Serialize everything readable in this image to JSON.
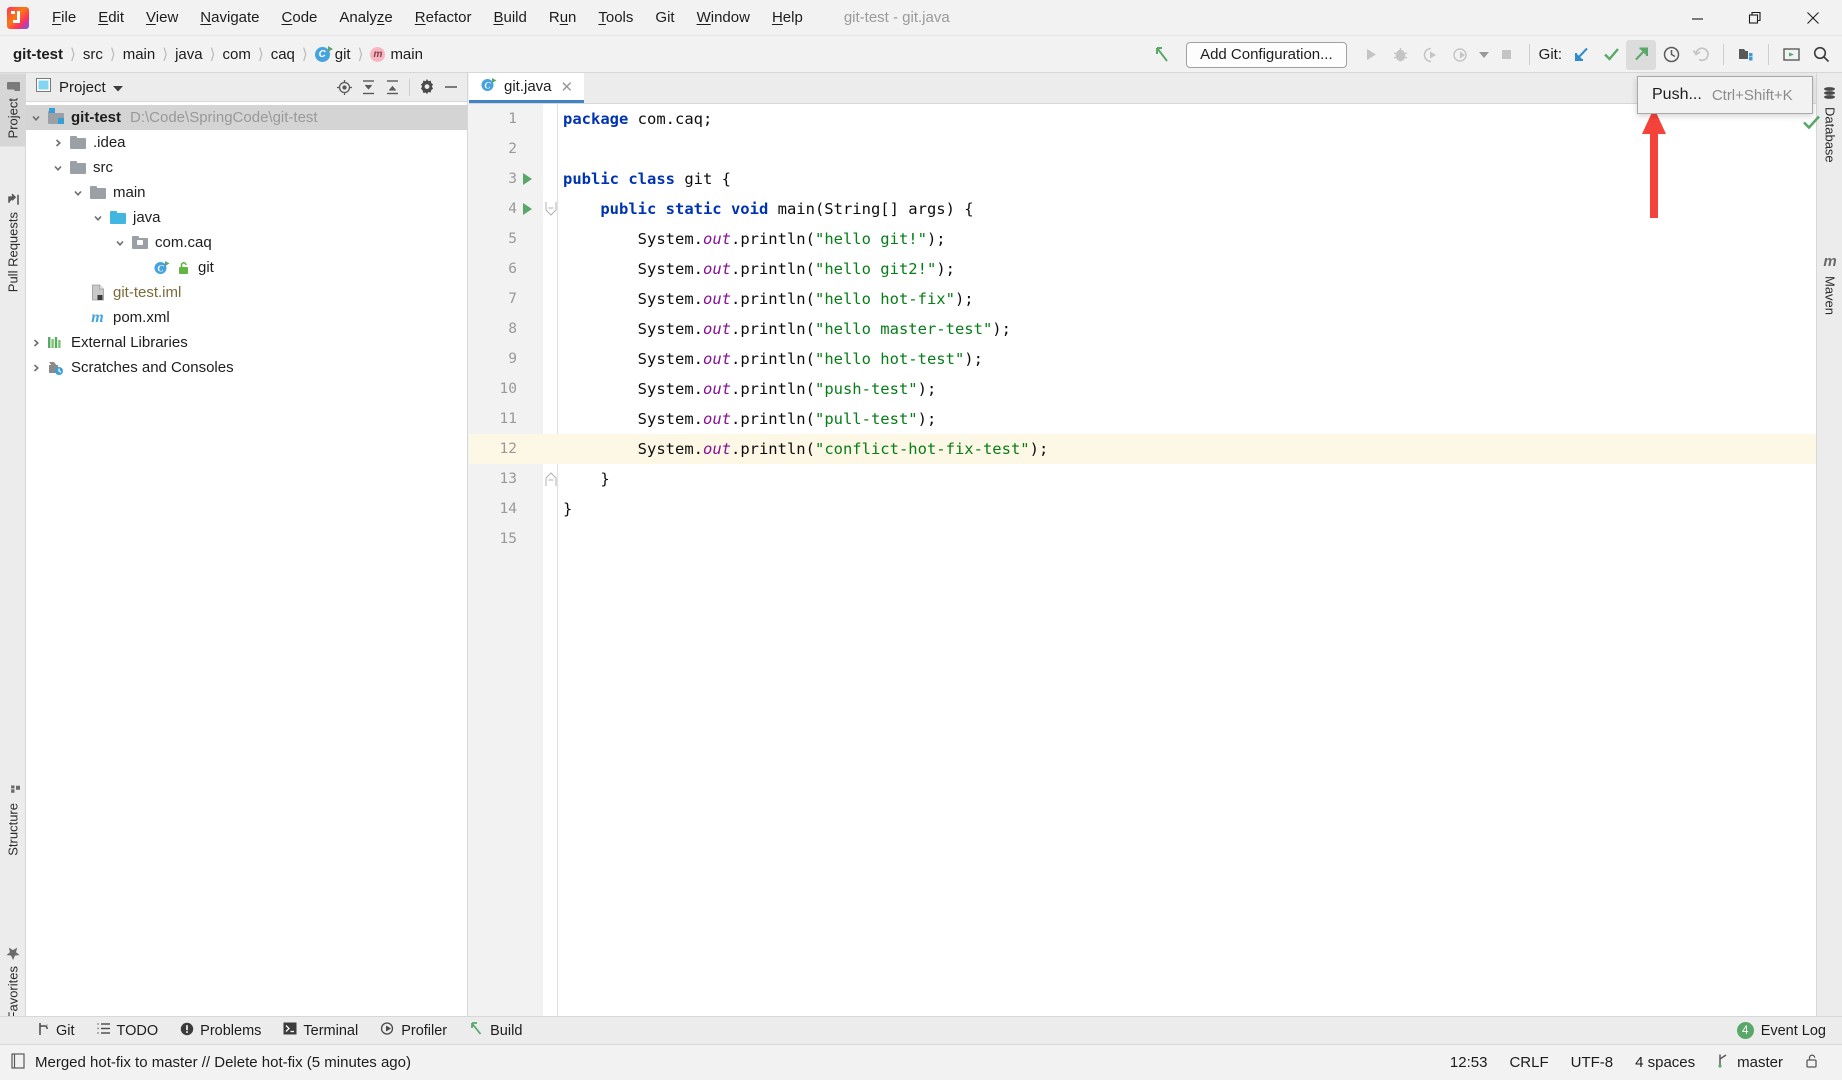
{
  "window": {
    "title": "git-test - git.java",
    "logo_icon": "intellij-idea-logo",
    "minimize_icon": "minimize-icon",
    "restore_icon": "restore-icon",
    "close_icon": "close-icon"
  },
  "menu": [
    {
      "label": "File",
      "mnemonic": "F"
    },
    {
      "label": "Edit",
      "mnemonic": "E"
    },
    {
      "label": "View",
      "mnemonic": "V"
    },
    {
      "label": "Navigate",
      "mnemonic": "N"
    },
    {
      "label": "Code",
      "mnemonic": "C"
    },
    {
      "label": "Analyze",
      "mnemonic": "z"
    },
    {
      "label": "Refactor",
      "mnemonic": "R"
    },
    {
      "label": "Build",
      "mnemonic": "B"
    },
    {
      "label": "Run",
      "mnemonic": "u"
    },
    {
      "label": "Tools",
      "mnemonic": "T"
    },
    {
      "label": "Git",
      "mnemonic": ""
    },
    {
      "label": "Window",
      "mnemonic": "W"
    },
    {
      "label": "Help",
      "mnemonic": "H"
    }
  ],
  "breadcrumbs": [
    {
      "label": "git-test",
      "bold": true,
      "icon": ""
    },
    {
      "label": "src",
      "bold": false,
      "icon": ""
    },
    {
      "label": "main",
      "bold": false,
      "icon": ""
    },
    {
      "label": "java",
      "bold": false,
      "icon": ""
    },
    {
      "label": "com",
      "bold": false,
      "icon": ""
    },
    {
      "label": "caq",
      "bold": false,
      "icon": ""
    },
    {
      "label": "git",
      "bold": false,
      "icon": "class-icon"
    },
    {
      "label": "main",
      "bold": false,
      "icon": "method-icon"
    }
  ],
  "toolbar": {
    "back_icon": "back-arrow-icon",
    "add_configuration_label": "Add Configuration...",
    "run_icon": "run-icon",
    "debug_icon": "debug-icon",
    "run_coverage_icon": "run-with-coverage-icon",
    "profile_icon": "profile-icon",
    "dropdown_icon": "chevron-down-icon",
    "stop_icon": "stop-icon",
    "git_label": "Git:",
    "git_update_icon": "git-update-project-icon",
    "git_commit_icon": "git-commit-icon",
    "git_push_icon": "git-push-icon",
    "git_history_icon": "git-history-icon",
    "git_rollback_icon": "git-rollback-icon",
    "project_structure_icon": "project-structure-icon",
    "select_in_icon": "select-in-icon",
    "search_icon": "search-everywhere-icon"
  },
  "tooltip": {
    "label": "Push...",
    "shortcut": "Ctrl+Shift+K",
    "annotation_color": "#f4433a"
  },
  "left_strip": {
    "tabs": [
      {
        "label": "Project",
        "icon": "project-icon",
        "selected": true
      },
      {
        "label": "Pull Requests",
        "icon": "pull-requests-icon",
        "selected": false
      }
    ],
    "bottom_tabs": [
      {
        "label": "Structure",
        "icon": "structure-icon"
      },
      {
        "label": "Favorites",
        "icon": "favorites-star-icon"
      }
    ]
  },
  "right_strip": {
    "tabs": [
      {
        "label": "Database",
        "icon": "database-icon"
      },
      {
        "label": "Maven",
        "icon": "maven-icon"
      }
    ]
  },
  "project_panel": {
    "title": "Project",
    "dropdown_icon": "chevron-down-icon",
    "panel_icon": "project-view-icon",
    "actions": [
      {
        "name": "locate-icon"
      },
      {
        "name": "expand-all-icon"
      },
      {
        "name": "collapse-all-icon"
      },
      {
        "name": "settings-gear-icon"
      },
      {
        "name": "hide-icon"
      }
    ],
    "tree": [
      {
        "label": "git-test",
        "secondary": "D:\\Code\\SpringCode\\git-test",
        "indent": 0,
        "chevron": "down",
        "icon": "module-folder-icon",
        "bold": true,
        "selected": true
      },
      {
        "label": ".idea",
        "secondary": "",
        "indent": 1,
        "chevron": "right",
        "icon": "folder-icon",
        "bold": false,
        "selected": false
      },
      {
        "label": "src",
        "secondary": "",
        "indent": 1,
        "chevron": "down",
        "icon": "folder-icon",
        "bold": false,
        "selected": false
      },
      {
        "label": "main",
        "secondary": "",
        "indent": 2,
        "chevron": "down",
        "icon": "folder-icon",
        "bold": false,
        "selected": false
      },
      {
        "label": "java",
        "secondary": "",
        "indent": 3,
        "chevron": "down",
        "icon": "source-folder-icon",
        "bold": false,
        "selected": false
      },
      {
        "label": "com.caq",
        "secondary": "",
        "indent": 4,
        "chevron": "down",
        "icon": "package-icon",
        "bold": false,
        "selected": false
      },
      {
        "label": "git",
        "secondary": "",
        "indent": 5,
        "chevron": "none",
        "icon": "java-class-icon",
        "bold": false,
        "selected": false
      },
      {
        "label": "git-test.iml",
        "secondary": "",
        "indent": 1,
        "chevron": "none",
        "icon": "iml-file-icon",
        "bold": false,
        "selected": false
      },
      {
        "label": "pom.xml",
        "secondary": "",
        "indent": 1,
        "chevron": "none",
        "icon": "maven-pom-icon",
        "bold": false,
        "selected": false
      },
      {
        "label": "External Libraries",
        "secondary": "",
        "indent": 0,
        "chevron": "right",
        "icon": "external-libraries-icon",
        "bold": false,
        "selected": false
      },
      {
        "label": "Scratches and Consoles",
        "secondary": "",
        "indent": 0,
        "chevron": "right",
        "icon": "scratches-icon",
        "bold": false,
        "selected": false
      }
    ]
  },
  "editor": {
    "tab": {
      "label": "git.java",
      "icon": "java-class-icon",
      "close_icon": "close-icon"
    },
    "highlighted_line": 12,
    "lines": [
      {
        "num": 1,
        "runmark": false,
        "fold": "none",
        "tokens": [
          {
            "t": "kw",
            "v": "package"
          },
          {
            "t": "pl",
            "v": " com.caq;"
          }
        ]
      },
      {
        "num": 2,
        "runmark": false,
        "fold": "none",
        "tokens": []
      },
      {
        "num": 3,
        "runmark": true,
        "fold": "none",
        "tokens": [
          {
            "t": "kw",
            "v": "public class"
          },
          {
            "t": "pl",
            "v": " git {"
          }
        ]
      },
      {
        "num": 4,
        "runmark": true,
        "fold": "open",
        "tokens": [
          {
            "t": "pl",
            "v": "    "
          },
          {
            "t": "kw",
            "v": "public static void"
          },
          {
            "t": "pl",
            "v": " main(String[] args) {"
          }
        ]
      },
      {
        "num": 5,
        "runmark": false,
        "fold": "none",
        "tokens": [
          {
            "t": "pl",
            "v": "        System."
          },
          {
            "t": "fld",
            "v": "out"
          },
          {
            "t": "pl",
            "v": ".println("
          },
          {
            "t": "str",
            "v": "\"hello git!\""
          },
          {
            "t": "pl",
            "v": ");"
          }
        ]
      },
      {
        "num": 6,
        "runmark": false,
        "fold": "none",
        "tokens": [
          {
            "t": "pl",
            "v": "        System."
          },
          {
            "t": "fld",
            "v": "out"
          },
          {
            "t": "pl",
            "v": ".println("
          },
          {
            "t": "str",
            "v": "\"hello git2!\""
          },
          {
            "t": "pl",
            "v": ");"
          }
        ]
      },
      {
        "num": 7,
        "runmark": false,
        "fold": "none",
        "tokens": [
          {
            "t": "pl",
            "v": "        System."
          },
          {
            "t": "fld",
            "v": "out"
          },
          {
            "t": "pl",
            "v": ".println("
          },
          {
            "t": "str",
            "v": "\"hello hot-fix\""
          },
          {
            "t": "pl",
            "v": ");"
          }
        ]
      },
      {
        "num": 8,
        "runmark": false,
        "fold": "none",
        "tokens": [
          {
            "t": "pl",
            "v": "        System."
          },
          {
            "t": "fld",
            "v": "out"
          },
          {
            "t": "pl",
            "v": ".println("
          },
          {
            "t": "str",
            "v": "\"hello master-test\""
          },
          {
            "t": "pl",
            "v": ");"
          }
        ]
      },
      {
        "num": 9,
        "runmark": false,
        "fold": "none",
        "tokens": [
          {
            "t": "pl",
            "v": "        System."
          },
          {
            "t": "fld",
            "v": "out"
          },
          {
            "t": "pl",
            "v": ".println("
          },
          {
            "t": "str",
            "v": "\"hello hot-test\""
          },
          {
            "t": "pl",
            "v": ");"
          }
        ]
      },
      {
        "num": 10,
        "runmark": false,
        "fold": "none",
        "tokens": [
          {
            "t": "pl",
            "v": "        System."
          },
          {
            "t": "fld",
            "v": "out"
          },
          {
            "t": "pl",
            "v": ".println("
          },
          {
            "t": "str",
            "v": "\"push-test\""
          },
          {
            "t": "pl",
            "v": ");"
          }
        ]
      },
      {
        "num": 11,
        "runmark": false,
        "fold": "none",
        "tokens": [
          {
            "t": "pl",
            "v": "        System."
          },
          {
            "t": "fld",
            "v": "out"
          },
          {
            "t": "pl",
            "v": ".println("
          },
          {
            "t": "str",
            "v": "\"pull-test\""
          },
          {
            "t": "pl",
            "v": ");"
          }
        ]
      },
      {
        "num": 12,
        "runmark": false,
        "fold": "none",
        "tokens": [
          {
            "t": "pl",
            "v": "        System."
          },
          {
            "t": "fld",
            "v": "out"
          },
          {
            "t": "pl",
            "v": ".println("
          },
          {
            "t": "str",
            "v": "\"conflict-hot-fix-test\""
          },
          {
            "t": "pl",
            "v": ");"
          }
        ]
      },
      {
        "num": 13,
        "runmark": false,
        "fold": "close",
        "tokens": [
          {
            "t": "pl",
            "v": "    }"
          }
        ]
      },
      {
        "num": 14,
        "runmark": false,
        "fold": "none",
        "tokens": [
          {
            "t": "pl",
            "v": "}"
          }
        ]
      },
      {
        "num": 15,
        "runmark": false,
        "fold": "none",
        "tokens": []
      }
    ]
  },
  "bottom_bar": {
    "tabs": [
      {
        "label": "Git",
        "icon": "git-branch-icon"
      },
      {
        "label": "TODO",
        "icon": "todo-list-icon"
      },
      {
        "label": "Problems",
        "icon": "problems-icon"
      },
      {
        "label": "Terminal",
        "icon": "terminal-icon"
      },
      {
        "label": "Profiler",
        "icon": "profiler-icon"
      },
      {
        "label": "Build",
        "icon": "build-hammer-icon"
      }
    ],
    "event_log": {
      "label": "Event Log",
      "count": "4"
    }
  },
  "status_bar": {
    "message": "Merged hot-fix to master // Delete hot-fix (5 minutes ago)",
    "message_icon": "log-icon",
    "time": "12:53",
    "line_separator": "CRLF",
    "encoding": "UTF-8",
    "indent": "4 spaces",
    "branch": "master",
    "branch_icon": "git-branch-icon",
    "lock_icon": "lock-open-icon"
  },
  "colors": {
    "accent_blue": "#4083c9",
    "green": "#59a869",
    "keyword": "#0033b3",
    "string": "#067d17",
    "field": "#871094",
    "highlight_line": "#fdf8e6"
  }
}
